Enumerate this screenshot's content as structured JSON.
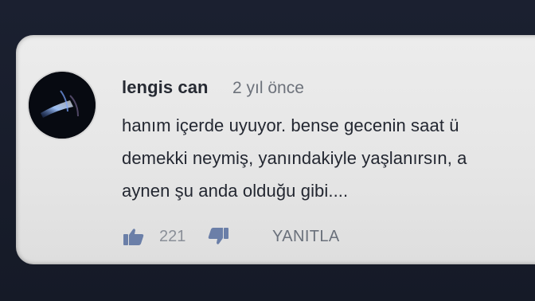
{
  "comment": {
    "author": "lengis can",
    "time": "2 yıl önce",
    "lines": [
      "hanım içerde uyuyor. bense gecenin saat ü",
      "demekki neymiş, yanındakiyle yaşlanırsın, a",
      "aynen şu anda olduğu gibi...."
    ],
    "like_count": "221",
    "reply_label": "YANITLA"
  },
  "icons": {
    "like": "thumbs-up-icon",
    "dislike": "thumbs-down-icon",
    "avatar": "avatar-image"
  },
  "colors": {
    "background": "#171c29",
    "card": "#e8e8e8",
    "icon": "#6b7fa8"
  }
}
